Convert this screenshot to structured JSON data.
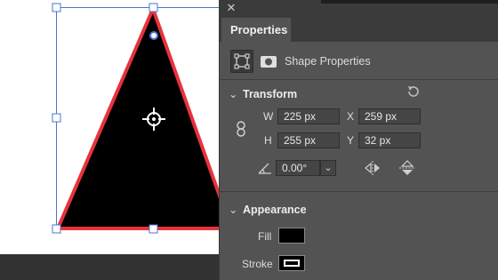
{
  "panel": {
    "tab_label": "Properties",
    "shape_properties_label": "Shape Properties"
  },
  "transform": {
    "heading": "Transform",
    "w_label": "W",
    "w_value": "225 px",
    "h_label": "H",
    "h_value": "255 px",
    "x_label": "X",
    "x_value": "259 px",
    "y_label": "Y",
    "y_value": "32 px",
    "angle_value": "0.00°"
  },
  "appearance": {
    "heading": "Appearance",
    "fill_label": "Fill",
    "stroke_label": "Stroke",
    "fill_color": "#000000",
    "stroke_color": "#e8323c"
  },
  "colors": {
    "selection": "#4a74d4",
    "panel_bg": "#535353",
    "canvas_bg": "#ffffff"
  }
}
